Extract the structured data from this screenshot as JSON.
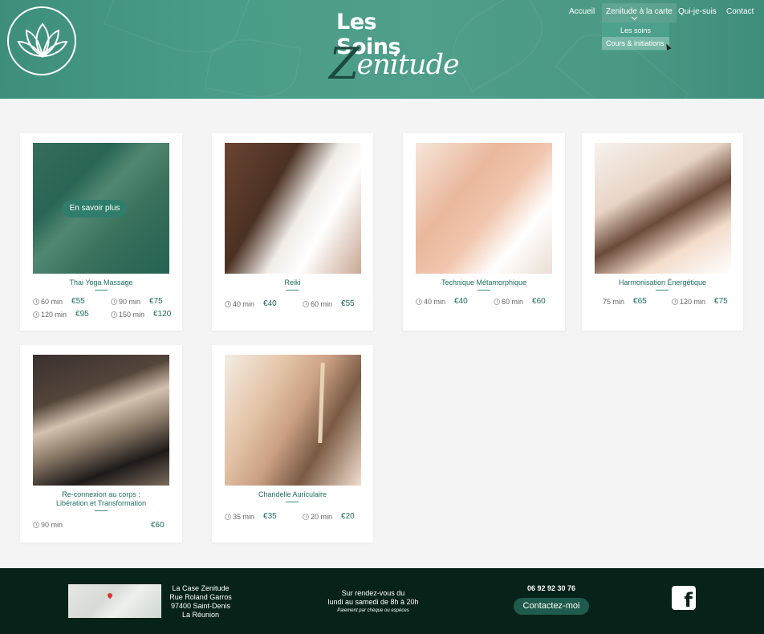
{
  "header": {
    "title": "Les Soins",
    "subtitle_initial": "Z",
    "subtitle_rest": "enitude"
  },
  "nav": {
    "items": [
      {
        "label": "Accueil"
      },
      {
        "label": "Zenitude à la carte"
      },
      {
        "label": "Qui-je-suis"
      },
      {
        "label": "Contact"
      }
    ],
    "dropdown": [
      {
        "label": "Les soins"
      },
      {
        "label": "Cours & initiations"
      }
    ]
  },
  "cards": [
    {
      "title": "Thai Yoga Massage",
      "hover_button": "En savoir plus",
      "prices": [
        {
          "duration": "60 min",
          "price": "€55"
        },
        {
          "duration": "90 min",
          "price": "€75"
        },
        {
          "duration": "120 min",
          "price": "€95"
        },
        {
          "duration": "150 min",
          "price": "€120"
        }
      ]
    },
    {
      "title": "Reiki",
      "prices": [
        {
          "duration": "40 min",
          "price": "€40"
        },
        {
          "duration": "60 min",
          "price": "€55"
        }
      ]
    },
    {
      "title": "Technique Métamorphique",
      "prices": [
        {
          "duration": "40 min",
          "price": "€40"
        },
        {
          "duration": "60 min",
          "price": "€60"
        }
      ]
    },
    {
      "title": "Harmonisation Énergétique",
      "prices": [
        {
          "duration": "75 min",
          "price": "€65"
        },
        {
          "duration": "120 min",
          "price": "€75"
        }
      ]
    },
    {
      "title_line1": "Re-connexion au corps :",
      "title_line2": "Libération et Transformation",
      "prices": [
        {
          "duration": "90 min",
          "price": "€60"
        }
      ]
    },
    {
      "title": "Chandelle Auriculaire",
      "prices": [
        {
          "duration": "35 min",
          "price": "€35"
        },
        {
          "duration": "20 min",
          "price": "€20"
        }
      ]
    }
  ],
  "footer": {
    "address": [
      "La Case Zenitude",
      "Rue Roland Garros",
      "97400 Saint-Denis",
      "La Réunion"
    ],
    "hours_line1": "Sur rendez-vous du",
    "hours_line2": "lundi au samedi de 8h à 20h",
    "payment_note": "Paiement par chèque ou espèces",
    "phone": "06 92 92 30 76",
    "contact_button": "Contactez-moi",
    "facebook_icon": "facebook-icon"
  },
  "colors": {
    "header_green": "#4a9d88",
    "accent_green": "#1f6e5d",
    "footer_dark": "#072219"
  }
}
